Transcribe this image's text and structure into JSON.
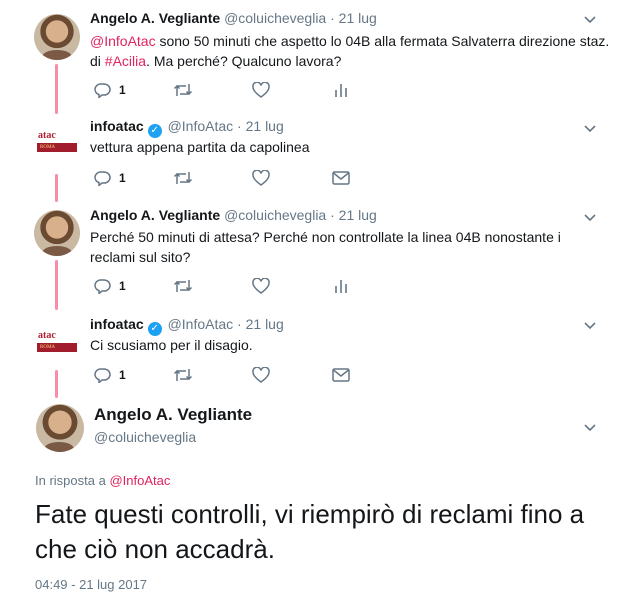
{
  "tweets": [
    {
      "name": "Angelo A. Vegliante",
      "handle": "@coluicheveglia",
      "dot": "·",
      "time": "21 lug",
      "mention": "@InfoAtac",
      "text_a": " sono 50 minuti che aspetto lo 04B alla fermata Salvaterra direzione staz. di ",
      "hashtag": "#Acilia",
      "text_b": ". Ma perché? Qualcuno lavora?",
      "reply_count": "1"
    },
    {
      "name": "infoatac",
      "handle": "@InfoAtac",
      "dot": "·",
      "time": "21 lug",
      "text": "vettura appena partita da capolinea",
      "reply_count": "1"
    },
    {
      "name": "Angelo A. Vegliante",
      "handle": "@coluicheveglia",
      "dot": "·",
      "time": "21 lug",
      "text": "Perché 50 minuti di attesa? Perché non controllate la linea 04B nonostante i reclami sul sito?",
      "reply_count": "1"
    },
    {
      "name": "infoatac",
      "handle": "@InfoAtac",
      "dot": "·",
      "time": "21 lug",
      "text": "Ci scusiamo per il disagio.",
      "reply_count": "1"
    }
  ],
  "main_tweet": {
    "name": "Angelo A. Vegliante",
    "handle": "@coluicheveglia",
    "reply_to_prefix": "In risposta a ",
    "reply_to_handle": "@InfoAtac",
    "text": "Fate questi controlli, vi riempirò di reclami fino a che ciò non accadrà.",
    "timestamp": "04:49 - 21 lug 2017"
  },
  "logo": {
    "word": "atac",
    "banner": "ROMA"
  },
  "colors": {
    "thread_line": "#f58ea8",
    "link": "#e0245e",
    "muted": "#657786",
    "verified": "#1da1f2"
  }
}
